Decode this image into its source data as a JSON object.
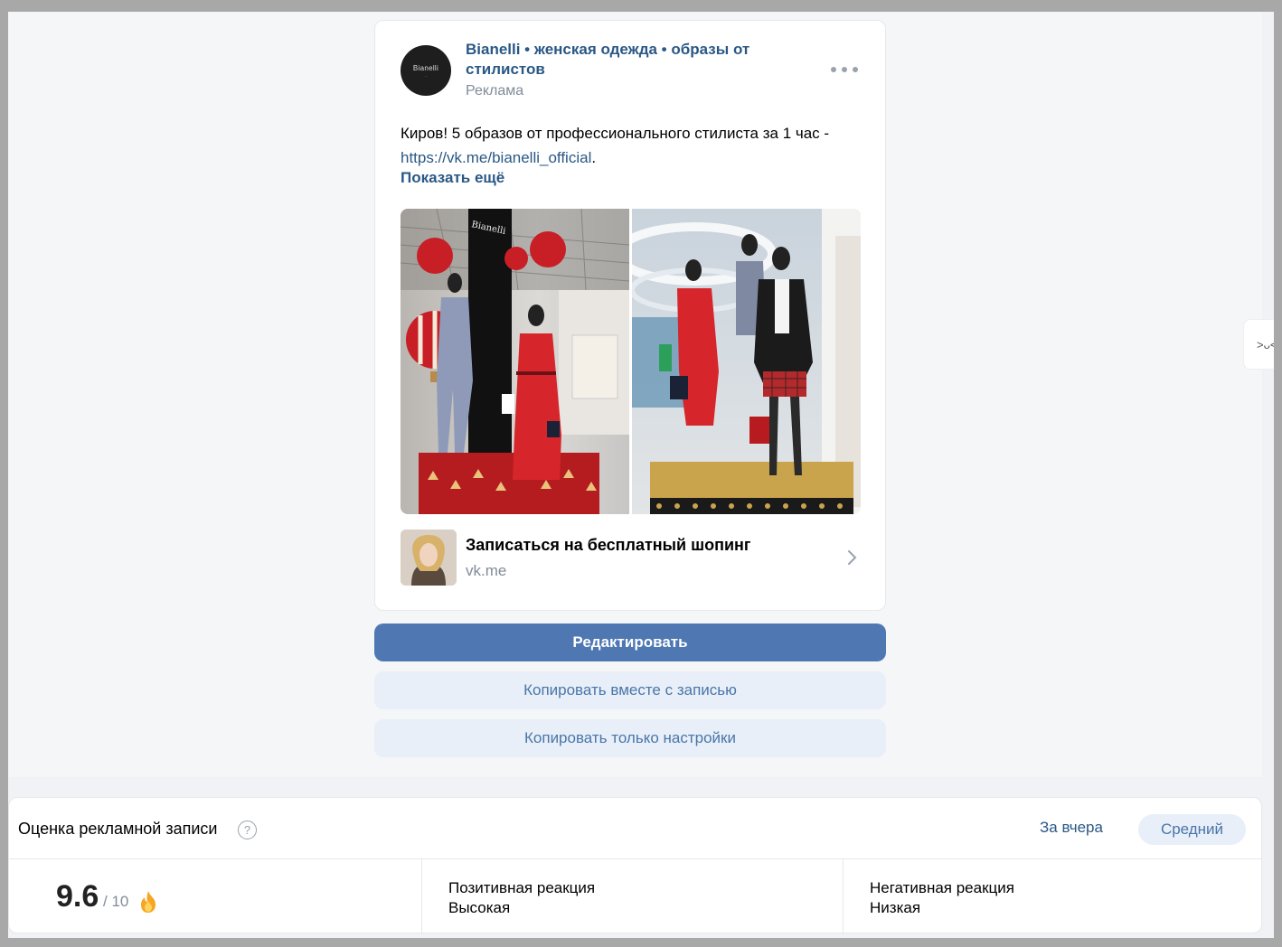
{
  "post": {
    "author": "Bianelli • женская одежда • образы от стилистов",
    "ad_label": "Реклама",
    "avatar_logo": "Bianelli",
    "text_before_link": "Киров! 5 образов от профессионального стилиста за 1 час - ",
    "link": "https://vk.me/bianelli_official",
    "text_after_link": ".",
    "show_more": "Показать ещё",
    "store_sign": "Bianelli",
    "cta": {
      "title": "Записаться на бесплатный шопинг",
      "domain": "vk.me"
    }
  },
  "buttons": {
    "edit": "Редактировать",
    "copy_with_post": "Копировать вместе с записью",
    "copy_settings_only": "Копировать только настройки"
  },
  "side_widget": {
    "label": ">ᴗ<"
  },
  "rating": {
    "title": "Оценка рекламной записи",
    "help": "?",
    "period": "За вчера",
    "level": "Средний",
    "score": "9.6",
    "score_max": "/ 10",
    "positive_label": "Позитивная реакция",
    "positive_value": "Высокая",
    "negative_label": "Негативная реакция",
    "negative_value": "Низкая"
  },
  "colors": {
    "link": "#2a5885",
    "primary_button": "#4f78b3",
    "secondary_button": "#e8eff8"
  }
}
